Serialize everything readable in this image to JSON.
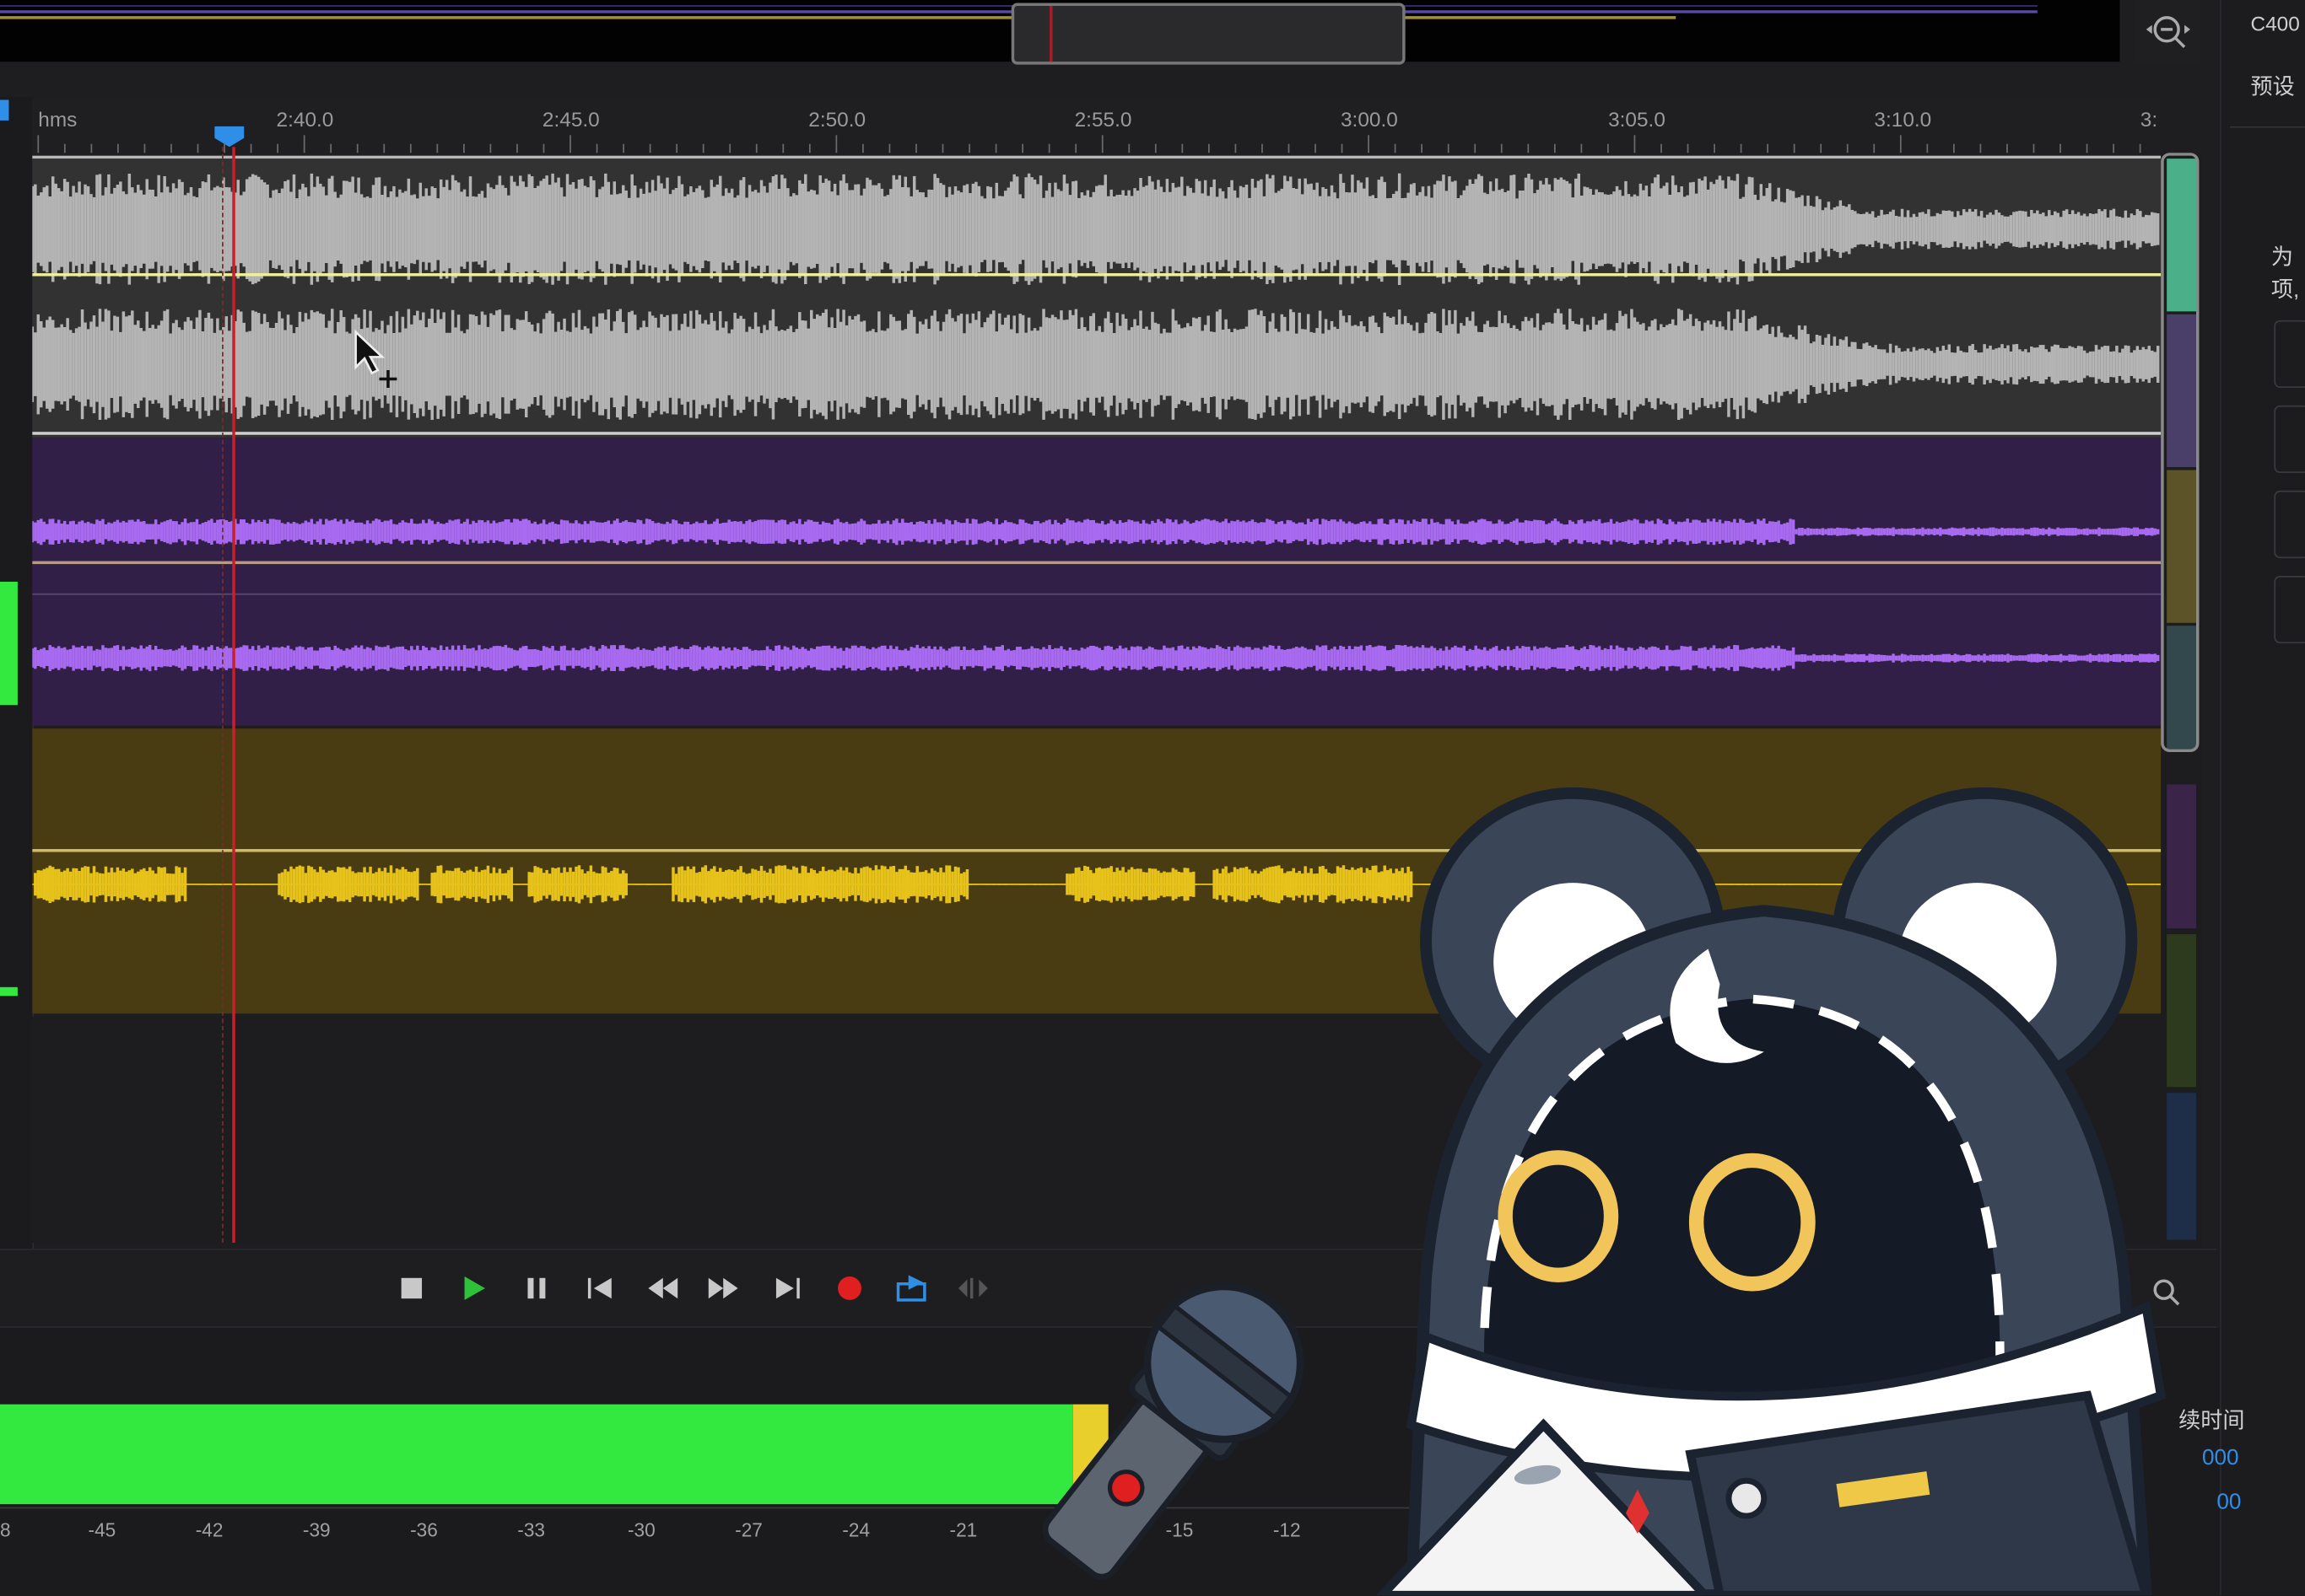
{
  "ruler": {
    "unit_label": "hms",
    "ticks": [
      "2:40.0",
      "2:45.0",
      "2:50.0",
      "2:55.0",
      "3:00.0",
      "3:05.0",
      "3:10.0",
      "3:"
    ]
  },
  "right_panel": {
    "label_c": "C400",
    "preset_label": "预设",
    "partial_1": "为",
    "partial_2": "项,",
    "duration_label": "续时间",
    "value_1": "000",
    "value_2": "00"
  },
  "meter": {
    "db_labels": [
      "8",
      "-45",
      "-42",
      "-39",
      "-36",
      "-33",
      "-30",
      "-27",
      "-24",
      "-21",
      "-15",
      "-12"
    ],
    "level_green_fraction": 0.73
  },
  "transport": {
    "buttons": [
      "stop",
      "play",
      "pause",
      "go-to-start",
      "rewind",
      "fast-forward",
      "go-to-end",
      "record",
      "loop",
      "skip-selection"
    ]
  },
  "colors": {
    "track1_bg": "#323232",
    "track1_wave": "#b4b4b4",
    "track2_bg": "#321f47",
    "track2_wave": "#a76af0",
    "track3_bg": "#4a3c12",
    "track3_wave": "#e6c21a",
    "playhead": "#c8202a",
    "meter_green": "#33e83f",
    "meter_yellow": "#e9cf2c",
    "record_red": "#e02020",
    "accent_blue": "#2f8fe8"
  }
}
